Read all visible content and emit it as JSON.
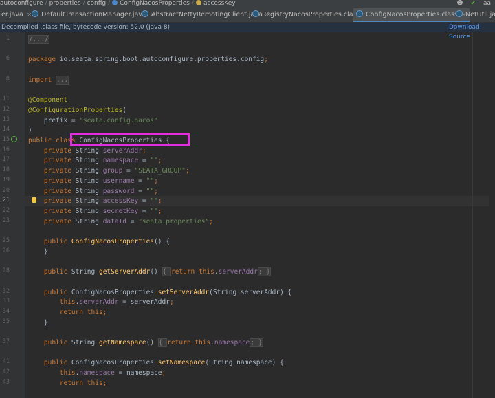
{
  "breadcrumb": {
    "items": [
      "autoconfigure",
      "properties",
      "config",
      "ConfigNacosProperties",
      "accessKey"
    ],
    "right_label": "aa"
  },
  "tabs": [
    {
      "label": "er.java"
    },
    {
      "label": "DefaultTransactionManager.java"
    },
    {
      "label": "AbstractNettyRemotingClient.java"
    },
    {
      "label": "RegistryNacosProperties.class"
    },
    {
      "label": "ConfigNacosProperties.class"
    },
    {
      "label": "NetUtil.java"
    }
  ],
  "infobar": {
    "message": "Decompiled .class file, bytecode version: 52.0 (Java 8)",
    "action": "Download Source"
  },
  "editor": {
    "current_line": "21",
    "lines": [
      {
        "n": "1",
        "tokens": [
          {
            "t": "/.../",
            "c": "fold"
          }
        ]
      },
      {
        "n": "",
        "tokens": []
      },
      {
        "n": "6",
        "tokens": [
          {
            "t": "package ",
            "c": "kw"
          },
          {
            "t": "io.seata.spring.boot.autoconfigure.properties.config",
            "c": ""
          },
          {
            "t": ";",
            "c": "kw"
          }
        ]
      },
      {
        "n": "",
        "tokens": []
      },
      {
        "n": "8",
        "tokens": [
          {
            "t": "import ",
            "c": "kw"
          },
          {
            "t": "...",
            "c": "fold"
          }
        ]
      },
      {
        "n": "",
        "tokens": []
      },
      {
        "n": "11",
        "tokens": [
          {
            "t": "@Component",
            "c": "an"
          }
        ]
      },
      {
        "n": "12",
        "tokens": [
          {
            "t": "@ConfigurationProperties",
            "c": "an"
          },
          {
            "t": "(",
            "c": ""
          }
        ]
      },
      {
        "n": "13",
        "tokens": [
          {
            "t": "    prefix = ",
            "c": ""
          },
          {
            "t": "\"seata.config.nacos\"",
            "c": "str"
          }
        ]
      },
      {
        "n": "14",
        "tokens": [
          {
            "t": ")",
            "c": ""
          }
        ]
      },
      {
        "n": "15",
        "tokens": [
          {
            "t": "public class ",
            "c": "kw"
          },
          {
            "t": "ConfigNacosProperties {",
            "c": ""
          }
        ]
      },
      {
        "n": "16",
        "tokens": [
          {
            "t": "    private ",
            "c": "kw"
          },
          {
            "t": "String ",
            "c": ""
          },
          {
            "t": "serverAddr",
            "c": "fld"
          },
          {
            "t": ";",
            "c": "kw"
          }
        ]
      },
      {
        "n": "17",
        "tokens": [
          {
            "t": "    private ",
            "c": "kw"
          },
          {
            "t": "String ",
            "c": ""
          },
          {
            "t": "namespace",
            "c": "fld"
          },
          {
            "t": " = ",
            "c": ""
          },
          {
            "t": "\"\"",
            "c": "str"
          },
          {
            "t": ";",
            "c": "kw"
          }
        ]
      },
      {
        "n": "18",
        "tokens": [
          {
            "t": "    private ",
            "c": "kw"
          },
          {
            "t": "String ",
            "c": ""
          },
          {
            "t": "group",
            "c": "fld"
          },
          {
            "t": " = ",
            "c": ""
          },
          {
            "t": "\"SEATA_GROUP\"",
            "c": "str"
          },
          {
            "t": ";",
            "c": "kw"
          }
        ]
      },
      {
        "n": "19",
        "tokens": [
          {
            "t": "    private ",
            "c": "kw"
          },
          {
            "t": "String ",
            "c": ""
          },
          {
            "t": "username",
            "c": "fld"
          },
          {
            "t": " = ",
            "c": ""
          },
          {
            "t": "\"\"",
            "c": "str"
          },
          {
            "t": ";",
            "c": "kw"
          }
        ]
      },
      {
        "n": "20",
        "tokens": [
          {
            "t": "    private ",
            "c": "kw"
          },
          {
            "t": "String ",
            "c": ""
          },
          {
            "t": "password",
            "c": "fld"
          },
          {
            "t": " = ",
            "c": ""
          },
          {
            "t": "\"\"",
            "c": "str"
          },
          {
            "t": ";",
            "c": "kw"
          }
        ]
      },
      {
        "n": "21",
        "tokens": [
          {
            "t": "    private ",
            "c": "kw"
          },
          {
            "t": "String ",
            "c": ""
          },
          {
            "t": "accessKey",
            "c": "fld"
          },
          {
            "t": " = ",
            "c": ""
          },
          {
            "t": "\"\"",
            "c": "str"
          },
          {
            "t": ";",
            "c": "kw"
          }
        ]
      },
      {
        "n": "22",
        "tokens": [
          {
            "t": "    private ",
            "c": "kw"
          },
          {
            "t": "String ",
            "c": ""
          },
          {
            "t": "secretKey",
            "c": "fld"
          },
          {
            "t": " = ",
            "c": ""
          },
          {
            "t": "\"\"",
            "c": "str"
          },
          {
            "t": ";",
            "c": "kw"
          }
        ]
      },
      {
        "n": "23",
        "tokens": [
          {
            "t": "    private ",
            "c": "kw"
          },
          {
            "t": "String ",
            "c": ""
          },
          {
            "t": "dataId",
            "c": "fld"
          },
          {
            "t": " = ",
            "c": ""
          },
          {
            "t": "\"seata.properties\"",
            "c": "str"
          },
          {
            "t": ";",
            "c": "kw"
          }
        ]
      },
      {
        "n": "",
        "tokens": []
      },
      {
        "n": "25",
        "tokens": [
          {
            "t": "    public ",
            "c": "kw"
          },
          {
            "t": "ConfigNacosProperties",
            "c": "fn"
          },
          {
            "t": "() {",
            "c": ""
          }
        ]
      },
      {
        "n": "26",
        "tokens": [
          {
            "t": "    }",
            "c": ""
          }
        ]
      },
      {
        "n": "",
        "tokens": []
      },
      {
        "n": "28",
        "tokens": [
          {
            "t": "    public ",
            "c": "kw"
          },
          {
            "t": "String ",
            "c": ""
          },
          {
            "t": "getServerAddr",
            "c": "fn"
          },
          {
            "t": "() ",
            "c": ""
          },
          {
            "t": "{ ",
            "c": "fold"
          },
          {
            "t": "return this",
            "c": "kw"
          },
          {
            "t": ".",
            "c": ""
          },
          {
            "t": "serverAddr",
            "c": "fld"
          },
          {
            "t": "; }",
            "c": "fold"
          }
        ]
      },
      {
        "n": "",
        "tokens": []
      },
      {
        "n": "32",
        "tokens": [
          {
            "t": "    public ",
            "c": "kw"
          },
          {
            "t": "ConfigNacosProperties ",
            "c": ""
          },
          {
            "t": "setServerAddr",
            "c": "fn"
          },
          {
            "t": "(String serverAddr) {",
            "c": ""
          }
        ]
      },
      {
        "n": "33",
        "tokens": [
          {
            "t": "        this",
            "c": "kw"
          },
          {
            "t": ".",
            "c": ""
          },
          {
            "t": "serverAddr",
            "c": "fld"
          },
          {
            "t": " = serverAddr",
            "c": ""
          },
          {
            "t": ";",
            "c": "kw"
          }
        ]
      },
      {
        "n": "34",
        "tokens": [
          {
            "t": "        return this",
            "c": "kw"
          },
          {
            "t": ";",
            "c": "kw"
          }
        ]
      },
      {
        "n": "35",
        "tokens": [
          {
            "t": "    }",
            "c": ""
          }
        ]
      },
      {
        "n": "",
        "tokens": []
      },
      {
        "n": "37",
        "tokens": [
          {
            "t": "    public ",
            "c": "kw"
          },
          {
            "t": "String ",
            "c": ""
          },
          {
            "t": "getNamespace",
            "c": "fn"
          },
          {
            "t": "() ",
            "c": ""
          },
          {
            "t": "{ ",
            "c": "fold"
          },
          {
            "t": "return this",
            "c": "kw"
          },
          {
            "t": ".",
            "c": ""
          },
          {
            "t": "namespace",
            "c": "fld"
          },
          {
            "t": "; }",
            "c": "fold"
          }
        ]
      },
      {
        "n": "",
        "tokens": []
      },
      {
        "n": "41",
        "tokens": [
          {
            "t": "    public ",
            "c": "kw"
          },
          {
            "t": "ConfigNacosProperties ",
            "c": ""
          },
          {
            "t": "setNamespace",
            "c": "fn"
          },
          {
            "t": "(String namespace) {",
            "c": ""
          }
        ]
      },
      {
        "n": "42",
        "tokens": [
          {
            "t": "        this",
            "c": "kw"
          },
          {
            "t": ".",
            "c": ""
          },
          {
            "t": "namespace",
            "c": "fld"
          },
          {
            "t": " = namespace",
            "c": ""
          },
          {
            "t": ";",
            "c": "kw"
          }
        ]
      },
      {
        "n": "43",
        "tokens": [
          {
            "t": "        return this",
            "c": "kw"
          },
          {
            "t": ";",
            "c": "kw"
          }
        ]
      }
    ]
  },
  "colors": {
    "background": "#2b2b2b",
    "keyword": "#cc7832",
    "annotation": "#bbb529",
    "string": "#6a8759",
    "field": "#9876aa",
    "method": "#ffc66d",
    "highlight_box": "#e02ee0"
  },
  "icons": [
    "class-icon",
    "key-icon",
    "user-icon",
    "run-gutter-icon",
    "lightbulb-icon"
  ]
}
